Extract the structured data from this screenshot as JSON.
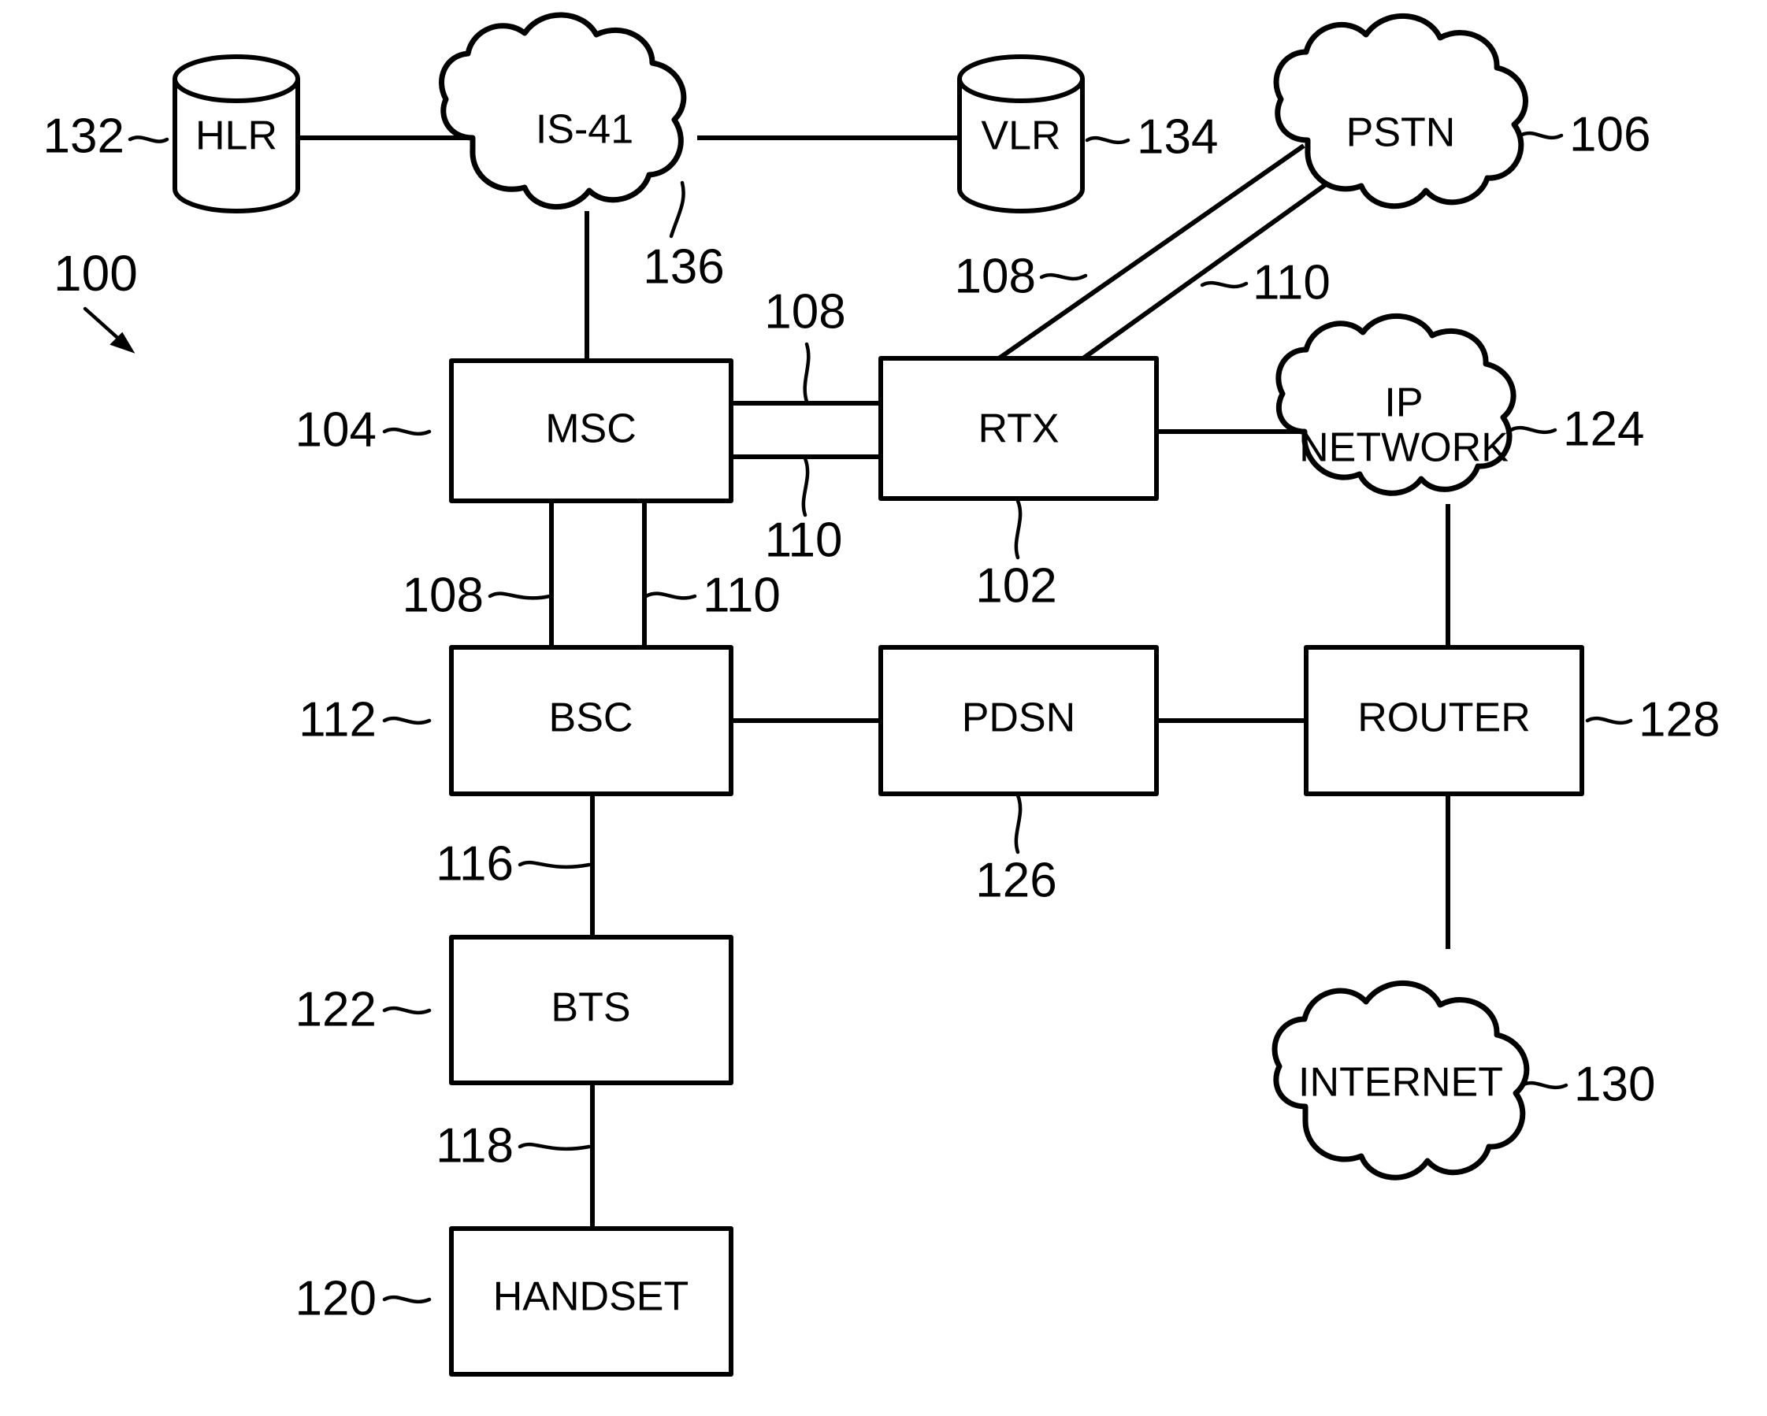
{
  "figure": {
    "figure_ref": "100",
    "domain": "patent-network-architecture-diagram",
    "background_color": "#ffffff",
    "line_color": "#000000"
  },
  "nodes": {
    "hlr": {
      "label": "HLR",
      "shape": "cylinder",
      "ref": "132"
    },
    "is41": {
      "label": "IS-41",
      "shape": "cloud",
      "ref": "136"
    },
    "vlr": {
      "label": "VLR",
      "shape": "cylinder",
      "ref": "134"
    },
    "pstn": {
      "label": "PSTN",
      "shape": "cloud",
      "ref": "106"
    },
    "msc": {
      "label": "MSC",
      "shape": "rect",
      "ref": "104"
    },
    "rtx": {
      "label": "RTX",
      "shape": "rect",
      "ref": "102"
    },
    "ipnet": {
      "label_line1": "IP",
      "label_line2": "NETWORK",
      "shape": "cloud",
      "ref": "124"
    },
    "bsc": {
      "label": "BSC",
      "shape": "rect",
      "ref": "112"
    },
    "pdsn": {
      "label": "PDSN",
      "shape": "rect",
      "ref": "126"
    },
    "router": {
      "label": "ROUTER",
      "shape": "rect",
      "ref": "128"
    },
    "bts": {
      "label": "BTS",
      "shape": "rect",
      "ref": "122"
    },
    "handset": {
      "label": "HANDSET",
      "shape": "rect",
      "ref": "120"
    },
    "internet": {
      "label": "INTERNET",
      "shape": "cloud",
      "ref": "130"
    }
  },
  "link_refs": {
    "pstn_rtx_voice": "108",
    "pstn_rtx_data": "110",
    "msc_rtx_voice": "108",
    "msc_rtx_data": "110",
    "msc_bsc_voice": "108",
    "msc_bsc_data": "110",
    "bsc_bts": "116",
    "bts_handset": "118"
  },
  "reference_numerals": [
    {
      "id": "r100",
      "text": "100",
      "target": "figure-callout"
    },
    {
      "id": "r132",
      "text": "132",
      "target": "hlr"
    },
    {
      "id": "r136",
      "text": "136",
      "target": "is41"
    },
    {
      "id": "r134",
      "text": "134",
      "target": "vlr"
    },
    {
      "id": "r106",
      "text": "106",
      "target": "pstn"
    },
    {
      "id": "r108a",
      "text": "108",
      "target": "pstn-rtx-link-voice"
    },
    {
      "id": "r110a",
      "text": "110",
      "target": "pstn-rtx-link-data"
    },
    {
      "id": "r104",
      "text": "104",
      "target": "msc"
    },
    {
      "id": "r108b",
      "text": "108",
      "target": "msc-rtx-link-voice"
    },
    {
      "id": "r110b",
      "text": "110",
      "target": "msc-rtx-link-data"
    },
    {
      "id": "r102",
      "text": "102",
      "target": "rtx"
    },
    {
      "id": "r124",
      "text": "124",
      "target": "ipnet"
    },
    {
      "id": "r108c",
      "text": "108",
      "target": "msc-bsc-link-voice"
    },
    {
      "id": "r110c",
      "text": "110",
      "target": "msc-bsc-link-data"
    },
    {
      "id": "r112",
      "text": "112",
      "target": "bsc"
    },
    {
      "id": "r126",
      "text": "126",
      "target": "pdsn"
    },
    {
      "id": "r128",
      "text": "128",
      "target": "router"
    },
    {
      "id": "r116",
      "text": "116",
      "target": "bsc-bts-link"
    },
    {
      "id": "r122",
      "text": "122",
      "target": "bts"
    },
    {
      "id": "r130",
      "text": "130",
      "target": "internet"
    },
    {
      "id": "r118",
      "text": "118",
      "target": "bts-handset-link"
    },
    {
      "id": "r120",
      "text": "120",
      "target": "handset"
    }
  ]
}
